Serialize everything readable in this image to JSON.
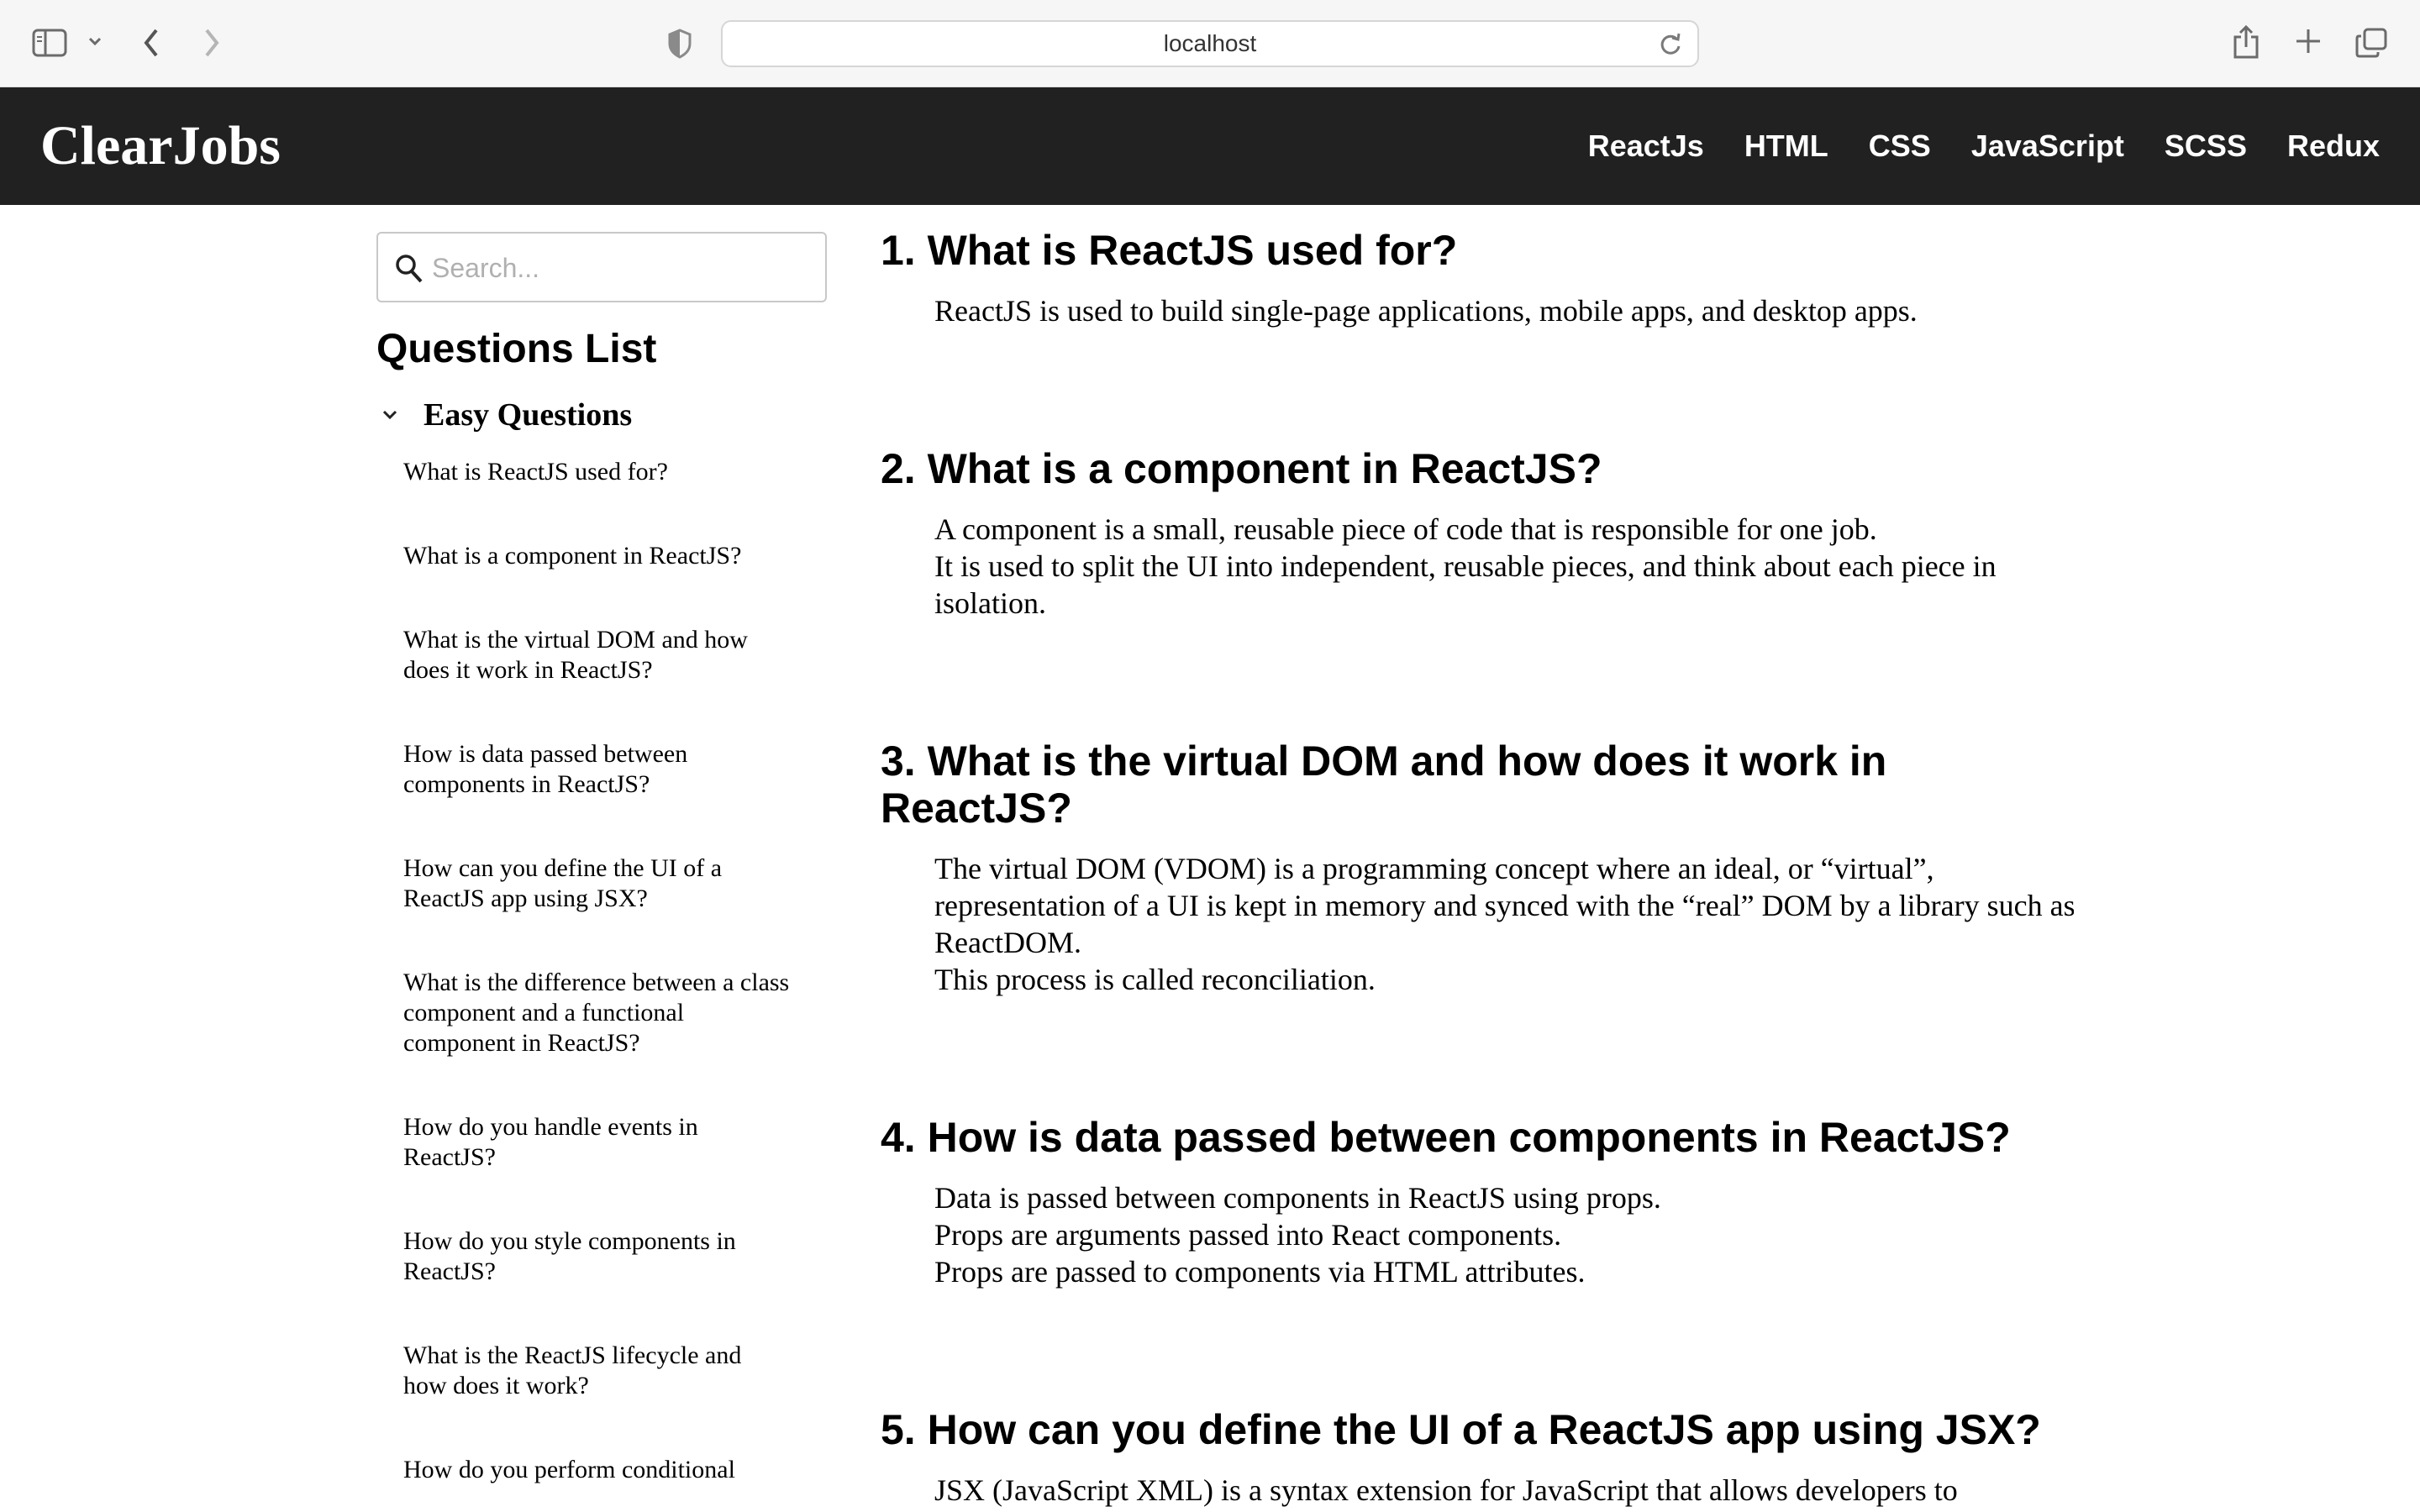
{
  "browser": {
    "url": "localhost"
  },
  "header": {
    "brand": "ClearJobs",
    "nav": [
      "ReactJs",
      "HTML",
      "CSS",
      "JavaScript",
      "SCSS",
      "Redux"
    ]
  },
  "sidebar": {
    "search_placeholder": "Search...",
    "title": "Questions List",
    "group_label": "Easy Questions",
    "items": [
      "What is ReactJS used for?",
      "What is a component in ReactJS?",
      "What is the virtual DOM and how does it work in ReactJS?",
      "How is data passed between components in ReactJS?",
      "How can you define the UI of a ReactJS app using JSX?",
      "What is the difference between a class component and a functional component in ReactJS?",
      "How do you handle events in ReactJS?",
      "How do you style components in ReactJS?",
      "What is the ReactJS lifecycle and how does it work?",
      "How do you perform conditional"
    ]
  },
  "questions": [
    {
      "title": "1. What is ReactJS used for?",
      "lines": [
        "ReactJS is used to build single-page applications, mobile apps, and desktop apps."
      ]
    },
    {
      "title": "2. What is a component in ReactJS?",
      "lines": [
        "A component is a small, reusable piece of code that is responsible for one job.",
        "It is used to split the UI into independent, reusable pieces, and think about each piece in isolation."
      ]
    },
    {
      "title": "3. What is the virtual DOM and how does it work in ReactJS?",
      "lines": [
        "The virtual DOM (VDOM) is a programming concept where an ideal, or “virtual”, representation of a UI is kept in memory and synced with the “real” DOM by a library such as ReactDOM.",
        "This process is called reconciliation."
      ]
    },
    {
      "title": "4. How is data passed between components in ReactJS?",
      "lines": [
        "Data is passed between components in ReactJS using props.",
        "Props are arguments passed into React components.",
        "Props are passed to components via HTML attributes."
      ]
    },
    {
      "title": "5. How can you define the UI of a ReactJS app using JSX?",
      "lines": [
        "JSX (JavaScript XML) is a syntax extension for JavaScript that allows developers to"
      ]
    }
  ]
}
